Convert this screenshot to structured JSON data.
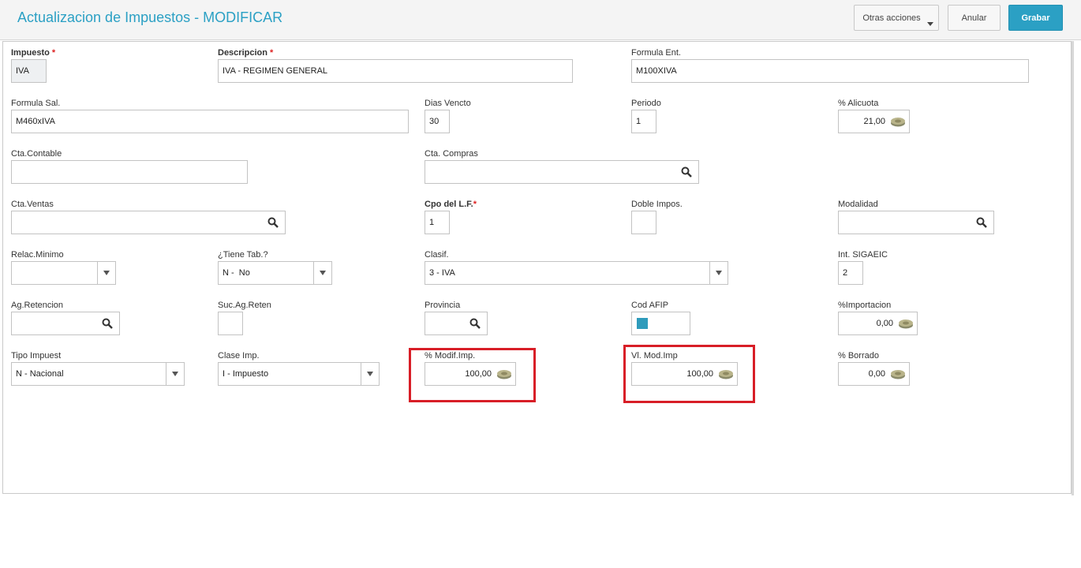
{
  "header": {
    "title": "Actualizacion de Impuestos - MODIFICAR",
    "buttons": {
      "more": "Otras acciones",
      "cancel": "Anular",
      "save": "Grabar"
    }
  },
  "form": {
    "impuesto": {
      "label": "Impuesto",
      "value": "IVA",
      "required": "*"
    },
    "descripcion": {
      "label": "Descripcion",
      "value": "IVA - REGIMEN GENERAL",
      "required": "*"
    },
    "formula_ent": {
      "label": "Formula Ent.",
      "value": "M100XIVA"
    },
    "formula_sal": {
      "label": "Formula Sal.",
      "value": "M460xIVA"
    },
    "dias_vencto": {
      "label": "Dias Vencto",
      "value": "30"
    },
    "periodo": {
      "label": "Periodo",
      "value": "1"
    },
    "alicuota": {
      "label": "% Alicuota",
      "value": "21,00"
    },
    "cta_contable": {
      "label": "Cta.Contable",
      "value": ""
    },
    "cta_compras": {
      "label": "Cta. Compras",
      "value": ""
    },
    "cta_ventas": {
      "label": "Cta.Ventas",
      "value": ""
    },
    "cpo_lf": {
      "label": "Cpo del L.F.",
      "value": "1",
      "required": "*"
    },
    "doble_impos": {
      "label": "Doble Impos.",
      "value": ""
    },
    "modalidad": {
      "label": "Modalidad",
      "value": ""
    },
    "relac_minimo": {
      "label": "Relac.Minimo",
      "value": ""
    },
    "tiene_tab": {
      "label": "¿Tiene Tab.?",
      "value": "N -  No"
    },
    "clasif": {
      "label": "Clasif.",
      "value": "3 - IVA"
    },
    "int_sigaeic": {
      "label": "Int. SIGAEIC",
      "value": "2"
    },
    "ag_retencion": {
      "label": "Ag.Retencion",
      "value": ""
    },
    "suc_ag_reten": {
      "label": "Suc.Ag.Reten",
      "value": ""
    },
    "provincia": {
      "label": "Provincia",
      "value": ""
    },
    "cod_afip": {
      "label": "Cod AFIP",
      "color": "#2e9bbb"
    },
    "importacion": {
      "label": "%Importacion",
      "value": "0,00"
    },
    "tipo_impuest": {
      "label": "Tipo Impuest",
      "value": "N - Nacional"
    },
    "clase_imp": {
      "label": "Clase Imp.",
      "value": "I - Impuesto"
    },
    "modif_imp": {
      "label": "% Modif.Imp.",
      "value": "100,00"
    },
    "vl_mod_imp": {
      "label": "Vl. Mod.Imp",
      "value": "100,00"
    },
    "borrado": {
      "label": "% Borrado",
      "value": "0,00"
    }
  },
  "colors": {
    "accent": "#2ba0c4",
    "highlight": "#d81e27"
  }
}
